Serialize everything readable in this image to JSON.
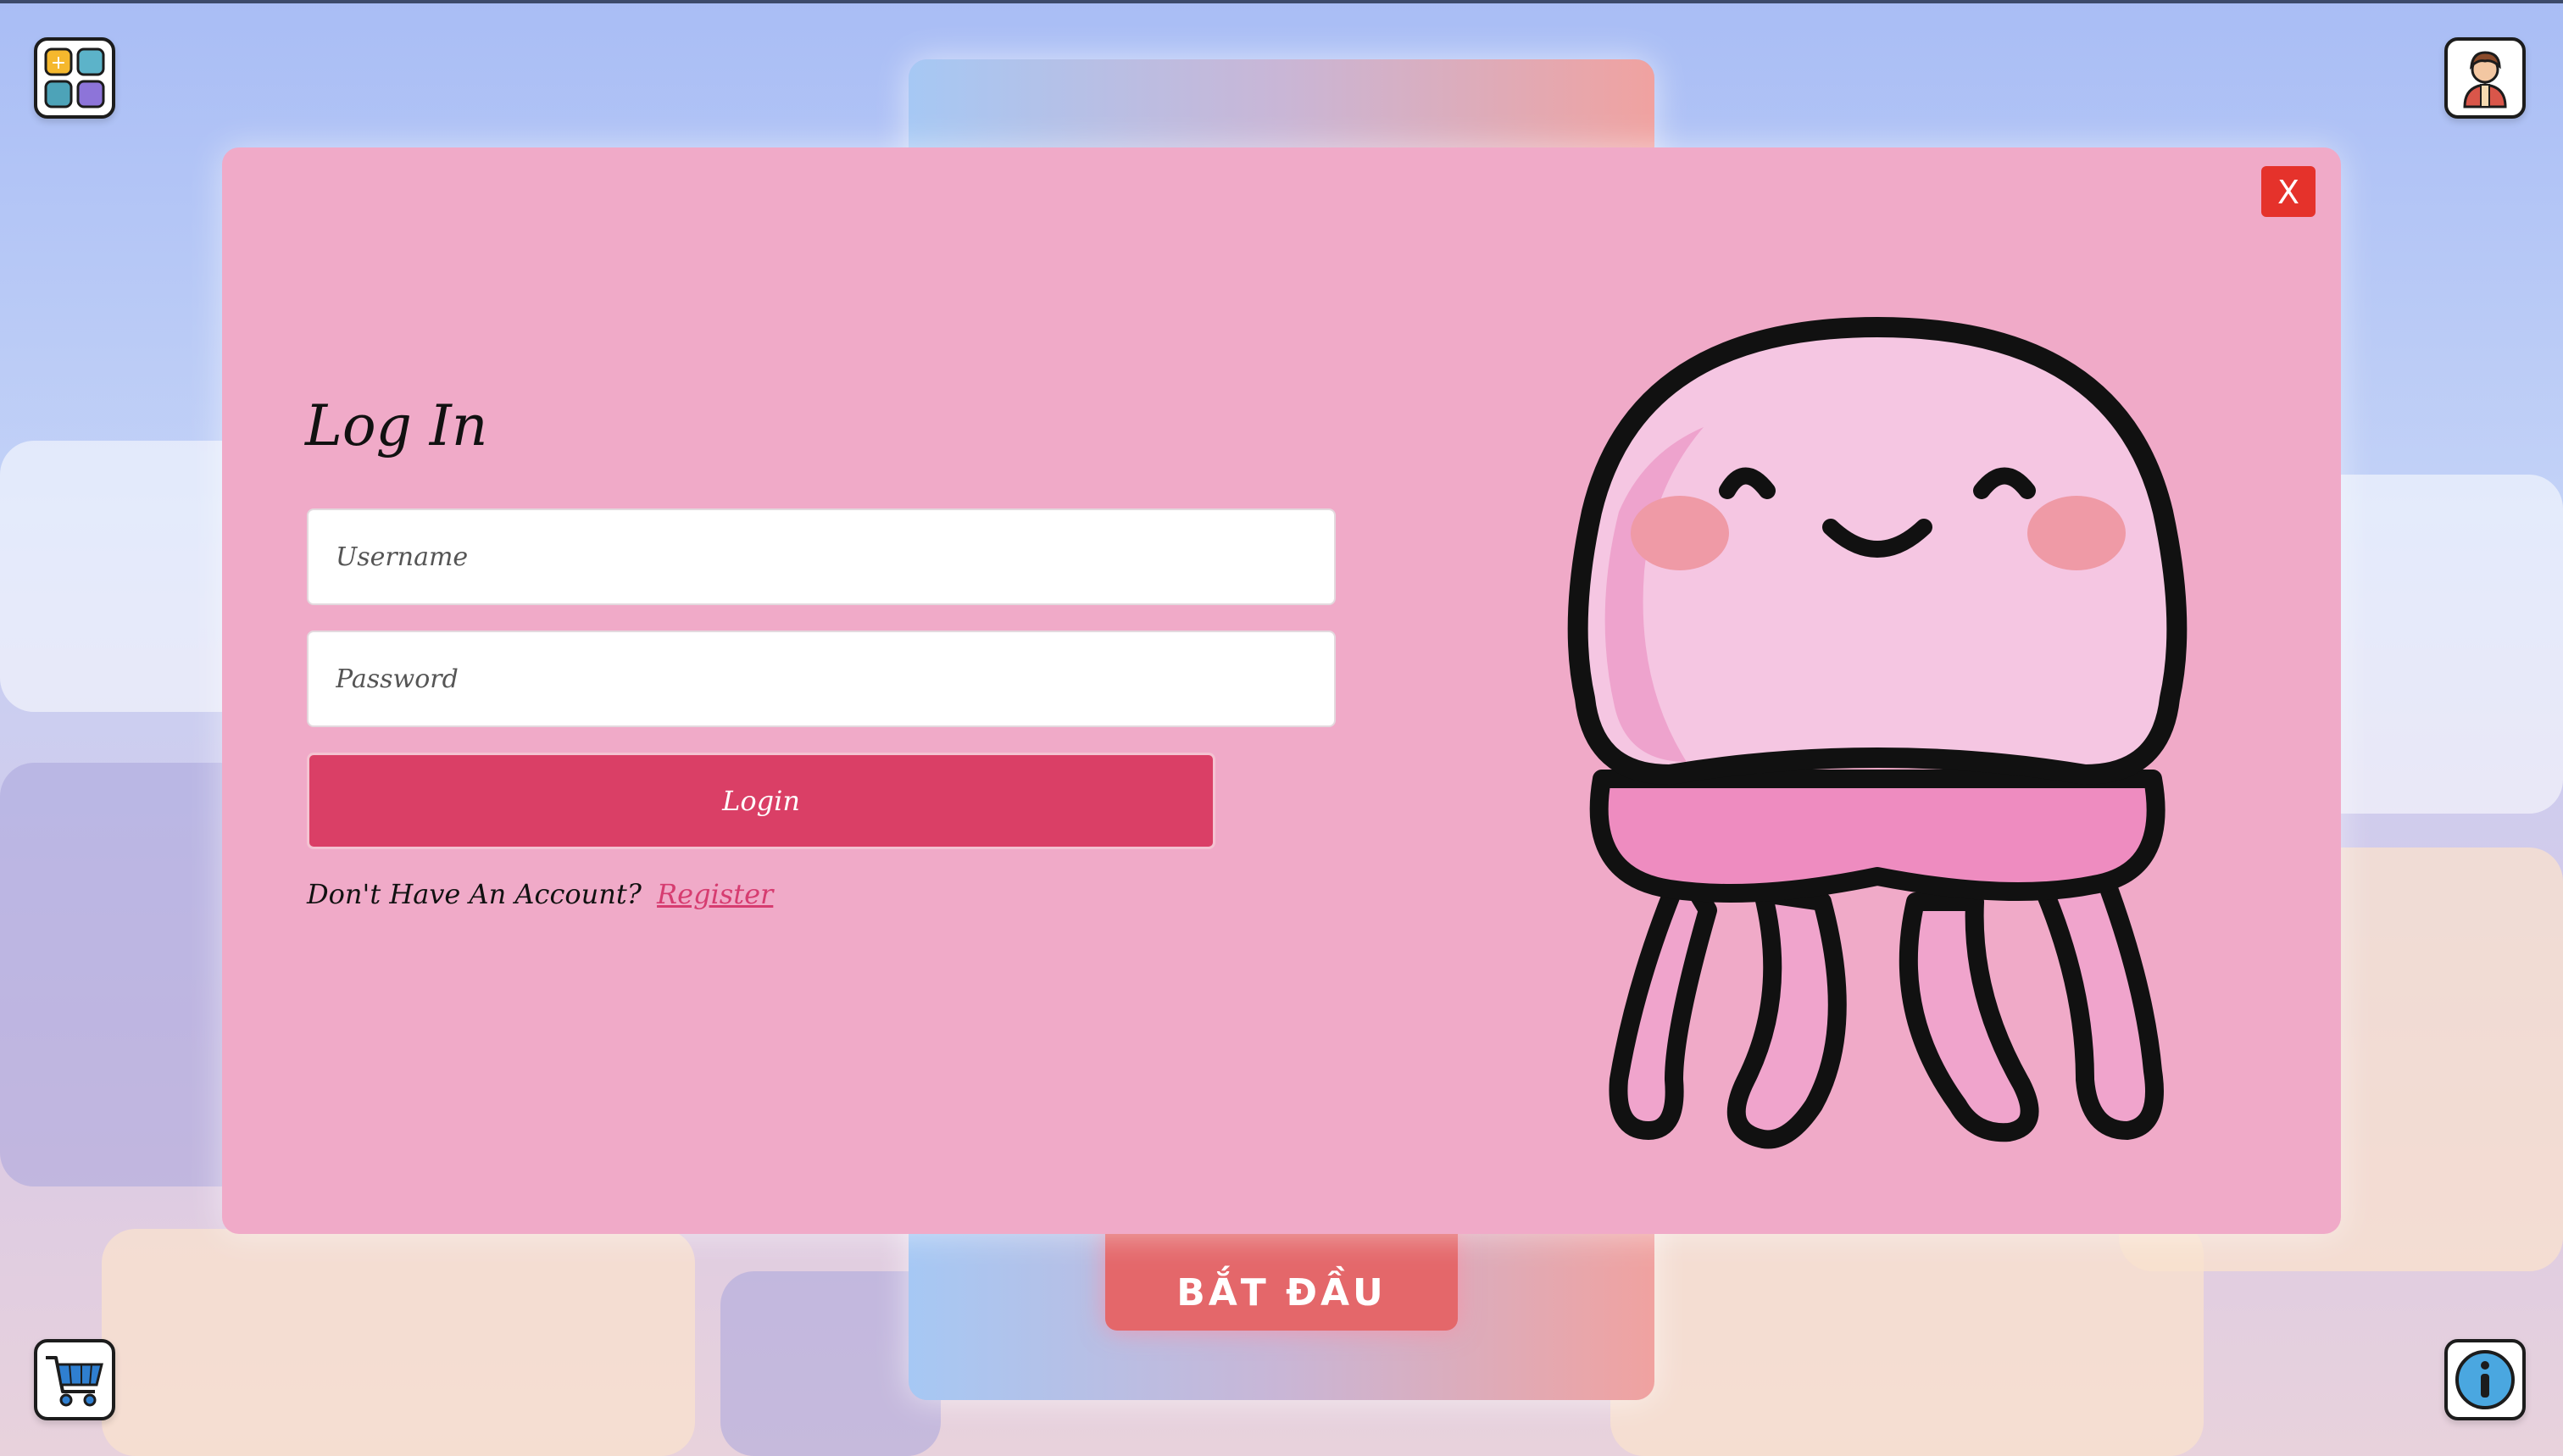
{
  "toolbar": {
    "apps_icon": "apps-grid-icon",
    "profile_icon": "user-avatar-icon",
    "cart_icon": "shopping-cart-icon",
    "info_icon": "info-icon"
  },
  "background": {
    "start_button_label": "BẮT ĐẦU"
  },
  "login_modal": {
    "close_label": "X",
    "title": "Log In",
    "username_placeholder": "Username",
    "password_placeholder": "Password",
    "login_button_label": "Login",
    "no_account_text": "Don't Have An Account?",
    "register_link_label": "Register",
    "illustration": "jellyfish-mascot"
  },
  "colors": {
    "modal_bg": "#f0aac8",
    "login_button": "#da3f66",
    "close_button": "#e5322b",
    "register_link": "#d63c70",
    "start_button": "#e4676a"
  }
}
